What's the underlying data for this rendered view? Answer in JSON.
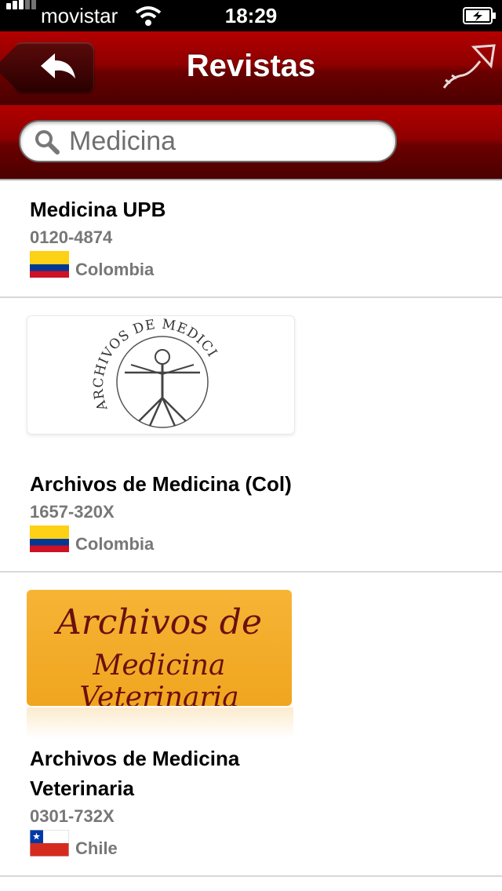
{
  "status_bar": {
    "carrier": "movistar",
    "time": "18:29"
  },
  "nav": {
    "title": "Revistas"
  },
  "search": {
    "value": "Medicina"
  },
  "items": [
    {
      "title": "Medicina UPB",
      "issn": "0120-4874",
      "country": "Colombia",
      "flag": "colombia-flag"
    },
    {
      "cover": {
        "text": "ARCHIVOS DE MEDICINA"
      },
      "title": "Archivos de Medicina (Col)",
      "issn": "1657-320X",
      "country": "Colombia",
      "flag": "colombia-flag"
    },
    {
      "cover": {
        "line1": "Archivos de",
        "line2": "Medicina Veterinaria"
      },
      "title_line1": "Archivos de Medicina",
      "title_line2": "Veterinaria",
      "issn": "0301-732X",
      "country": "Chile",
      "flag": "chile-flag"
    }
  ],
  "colors": {
    "nav_red": "#8e0000",
    "text_gray": "#777777"
  }
}
